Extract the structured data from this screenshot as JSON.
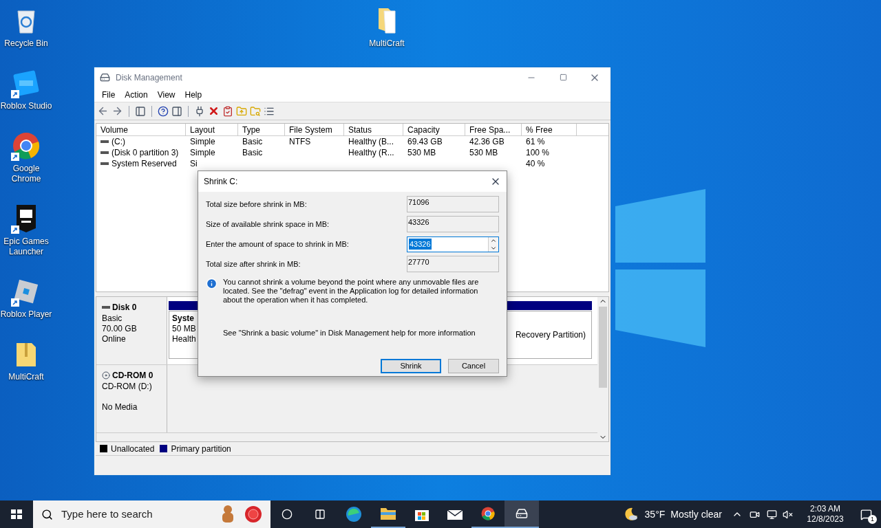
{
  "desktop_icons": [
    {
      "label": "Recycle Bin",
      "kind": "recycle",
      "shortcut": false
    },
    {
      "label": "Roblox Studio",
      "kind": "studio",
      "shortcut": true
    },
    {
      "label": "Google Chrome",
      "kind": "chrome",
      "shortcut": true
    },
    {
      "label": "Epic Games Launcher",
      "kind": "epic",
      "shortcut": true
    },
    {
      "label": "Roblox Player",
      "kind": "roblox",
      "shortcut": true
    },
    {
      "label": "MultiCraft",
      "kind": "zip",
      "shortcut": false
    }
  ],
  "top_icon": {
    "label": "MultiCraft",
    "kind": "folder",
    "shortcut": false
  },
  "window": {
    "title": "Disk Management",
    "menu": [
      "File",
      "Action",
      "View",
      "Help"
    ],
    "table": {
      "columns": [
        "Volume",
        "Layout",
        "Type",
        "File System",
        "Status",
        "Capacity",
        "Free Spa...",
        "% Free"
      ],
      "rows": [
        {
          "cells": [
            "(C:)",
            "Simple",
            "Basic",
            "NTFS",
            "Healthy (B...",
            "69.43 GB",
            "42.36 GB",
            "61 %"
          ]
        },
        {
          "cells": [
            "(Disk 0 partition 3)",
            "Simple",
            "Basic",
            null,
            "Healthy (R...",
            "530 MB",
            "530 MB",
            "100 %"
          ]
        },
        {
          "cells": [
            "System Reserved",
            "Si",
            null,
            null,
            null,
            null,
            null,
            "40 %"
          ]
        }
      ]
    },
    "disks": [
      {
        "kind": "disk",
        "name": "Disk 0",
        "lines": [
          "Basic",
          "70.00 GB",
          "Online"
        ],
        "partition_left": [
          "Syste",
          "50 MB",
          "Health"
        ],
        "partition_right": "Recovery Partition)"
      },
      {
        "kind": "cdrom",
        "name": "CD-ROM 0",
        "lines": [
          "CD-ROM (D:)"
        ],
        "status": "No Media"
      }
    ],
    "legend": [
      {
        "label": "Unallocated",
        "color": "#000000"
      },
      {
        "label": "Primary partition",
        "color": "#000080"
      }
    ]
  },
  "dialog": {
    "title": "Shrink C:",
    "fields": [
      {
        "label": "Total size before shrink in MB:",
        "value": "71096",
        "kind": "readonly"
      },
      {
        "label": "Size of available shrink space in MB:",
        "value": "43326",
        "kind": "readonly"
      },
      {
        "label": "Enter the amount of space to shrink in MB:",
        "value": "43326",
        "kind": "spin",
        "highlighted": true
      },
      {
        "label": "Total size after shrink in MB:",
        "value": "27770",
        "kind": "readonly"
      }
    ],
    "info": "You cannot shrink a volume beyond the point where any unmovable files are located. See the \"defrag\" event in the Application log for detailed information about the operation when it has completed.",
    "help": "See \"Shrink a basic volume\" in Disk Management help for more information",
    "buttons": [
      {
        "label": "Shrink",
        "default": true
      },
      {
        "label": "Cancel",
        "default": false
      }
    ]
  },
  "taskbar": {
    "search_placeholder": "Type here to search",
    "weather_temp": "35°F",
    "weather_text": "Mostly clear",
    "time": "2:03 AM",
    "date": "12/8/2023",
    "notifications": "1"
  }
}
